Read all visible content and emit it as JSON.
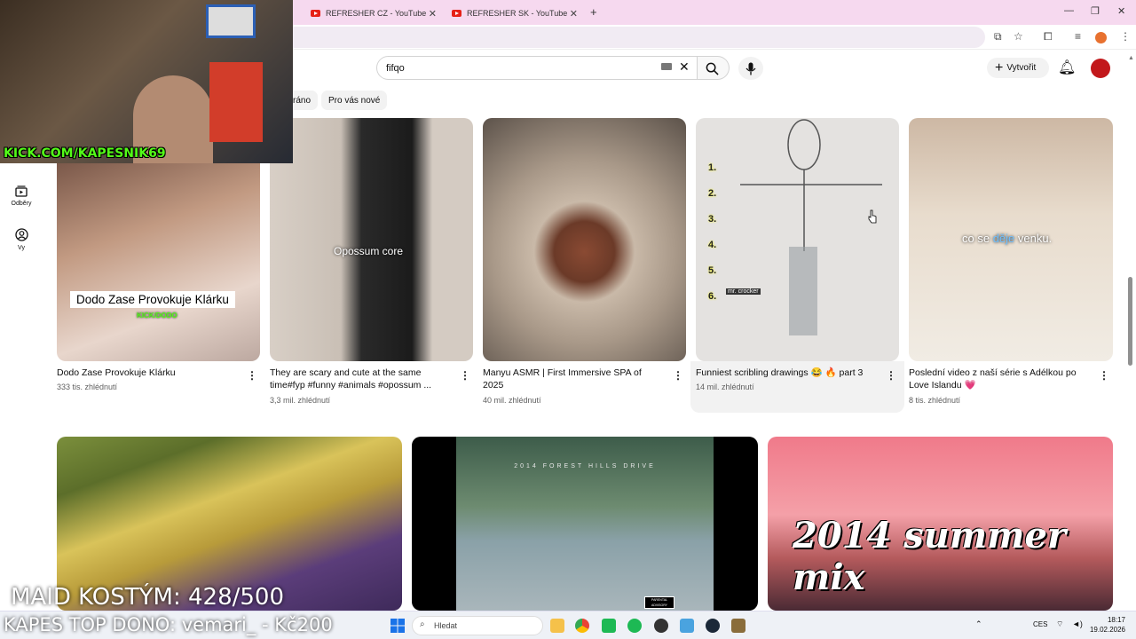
{
  "browser": {
    "tabs": [
      {
        "label": "REFRESHER CZ - YouTube"
      },
      {
        "label": "REFRESHER SK - YouTube"
      }
    ]
  },
  "header": {
    "search_value": "fifqo",
    "create_label": "Vytvořit"
  },
  "chips": [
    "ráno",
    "Pro vás nové"
  ],
  "sidebar": [
    {
      "label": "Odběry",
      "icon": "subscriptions-icon"
    },
    {
      "label": "Vy",
      "icon": "you-icon"
    }
  ],
  "shorts": [
    {
      "title": "Dodo Zase Provokuje Klárku",
      "views": "333 tis. zhlédnutí",
      "overlay": "Dodo Zase Provokuje Klárku",
      "badge": "KICK/DODO"
    },
    {
      "title": "They are scary and cute at the same time#fyp #funny #animals #opossum ...",
      "views": "3,3 mil. zhlédnutí",
      "overlay": "Opossum core"
    },
    {
      "title": "Manyu ASMR | First Immersive SPA of 2025",
      "views": "40 mil. zhlédnutí"
    },
    {
      "title": "Funniest scribling drawings 😂 🔥 part 3",
      "views": "14 mil. zhlédnutí",
      "labels": [
        "1.",
        "2.",
        "3.",
        "4.",
        "5.",
        "6."
      ],
      "caption": "mr. crocker"
    },
    {
      "title": "Poslední video z naší série s Adélkou po Love Islandu 💗",
      "views": "8 tis. zhlédnutí",
      "overlay_a": "co se ",
      "overlay_b": "děje",
      "overlay_c": " venku."
    }
  ],
  "videos": [
    {
      "thumb_text": ""
    },
    {
      "thumb_text": "2014 FOREST HILLS DRIVE",
      "advisory": "PARENTAL ADVISORY"
    },
    {
      "thumb_text": "2014 summer mix"
    }
  ],
  "stream": {
    "kick_url": "KICK.COM/KAPESNIK69",
    "goal_text": "MAID KOSTÝM: 428/500",
    "top_dono": "KAPES TOP DONO: vemari_ - Kč200"
  },
  "taskbar": {
    "search_placeholder": "Hledat",
    "lang": "CES",
    "time": "18:17",
    "date": "19.02.2026"
  }
}
